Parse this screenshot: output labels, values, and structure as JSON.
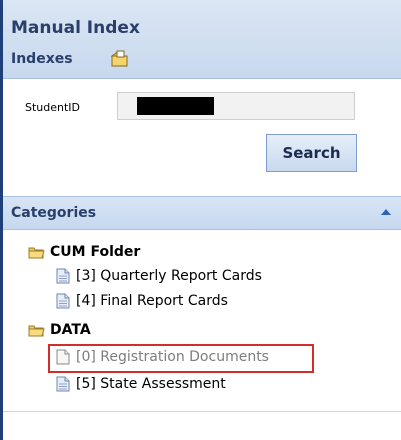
{
  "header": {
    "title": "Manual Index",
    "subtitle": "Indexes",
    "icon": "folder-icon"
  },
  "form": {
    "student_label": "StudentID",
    "student_value": "",
    "search_label": "Search"
  },
  "categories": {
    "title": "Categories",
    "collapse_icon": "chevron-up-icon",
    "folders": [
      {
        "label": "CUM Folder",
        "items": [
          {
            "label": "[3] Quarterly Report Cards",
            "disabled": false
          },
          {
            "label": "[4] Final Report Cards",
            "disabled": false
          }
        ]
      },
      {
        "label": "DATA",
        "items": [
          {
            "label": "[0] Registration Documents",
            "disabled": true
          },
          {
            "label": "[5] State Assessment",
            "disabled": false
          }
        ]
      }
    ]
  },
  "colors": {
    "accent": "#2a3f6a",
    "highlight": "#d12d2d"
  }
}
